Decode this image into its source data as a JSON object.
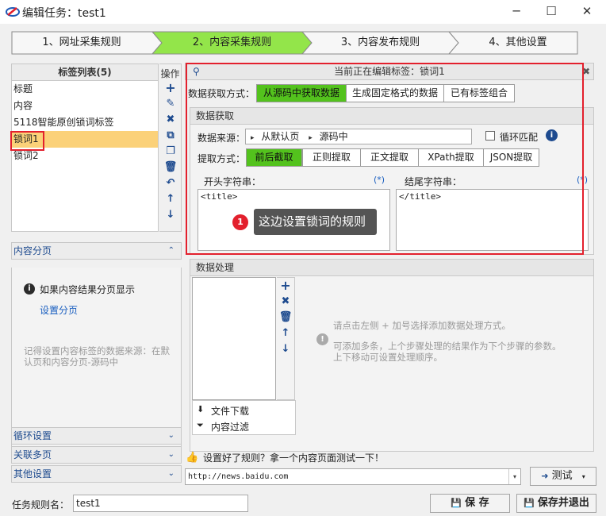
{
  "window": {
    "title": "编辑任务：test1",
    "minimize": "─",
    "maximize": "☐",
    "close": "✕"
  },
  "steps": [
    "1、网址采集规则",
    "2、内容采集规则",
    "3、内容发布规则",
    "4、其他设置"
  ],
  "tag_list": {
    "header": "标签列表(5)",
    "items": [
      {
        "label": "标题",
        "selected": false
      },
      {
        "label": "内容",
        "selected": false
      },
      {
        "label": "5118智能原创锁词标签",
        "selected": false
      },
      {
        "label": "锁词1",
        "selected": true
      },
      {
        "label": "锁词2",
        "selected": false
      }
    ],
    "ops_label": "操作",
    "ops_icons": [
      "plus-icon",
      "pencil-icon",
      "close-icon",
      "copy-icon",
      "paste-icon",
      "trash-icon",
      "undo-icon",
      "arrow-up-icon",
      "arrow-down-icon"
    ]
  },
  "content_paging": {
    "title": "内容分页",
    "info": "如果内容结果分页显示",
    "link": "设置分页",
    "hint": "记得设置内容标签的数据来源：在默认页和内容分页-源码中"
  },
  "loop_settings": "循环设置",
  "multi_page": "关联多页",
  "other_settings": "其他设置",
  "editing": {
    "label": "当前正在编辑标签：锁词1"
  },
  "fetch_method": {
    "label": "数据获取方式：",
    "options": [
      "从源码中获取数据",
      "生成固定格式的数据",
      "已有标签组合"
    ],
    "active": 0
  },
  "data_fetch": {
    "title": "数据获取",
    "source_label": "数据来源：",
    "source_parts": [
      "从默认页",
      "源码中"
    ],
    "loop_match": "循环匹配",
    "extract_label": "提取方式：",
    "extract_options": [
      "前后截取",
      "正则提取",
      "正文提取",
      "XPath提取",
      "JSON提取"
    ],
    "extract_active": 0,
    "start_label": "开头字符串：",
    "start_value": "<title>",
    "end_label": "结尾字符串：",
    "end_value": "</title>",
    "wildcard": "(*)"
  },
  "callout": {
    "num": "1",
    "text": "这边设置锁词的规则"
  },
  "data_process": {
    "title": "数据处理",
    "file_download": "文件下载",
    "content_filter": "内容过滤",
    "hint1": "请点击左侧 + 加号选择添加数据处理方式。",
    "hint2": "可添加多条，上个步骤处理的结果作为下个步骤的参数。上下移动可设置处理顺序。"
  },
  "test": {
    "prompt": "设置好了规则？拿一个内容页面测试一下！",
    "url": "http://news.baidu.com",
    "button": "测试"
  },
  "footer": {
    "rule_name_label": "任务规则名：",
    "rule_name_value": "test1",
    "save": "保 存",
    "save_exit": "保存并退出"
  },
  "colors": {
    "accent_green": "#53c21d",
    "step_active": "#93e54a",
    "selected_row": "#fbd179",
    "highlight_red": "#e3202d",
    "icon_blue": "#1e4b8f"
  }
}
